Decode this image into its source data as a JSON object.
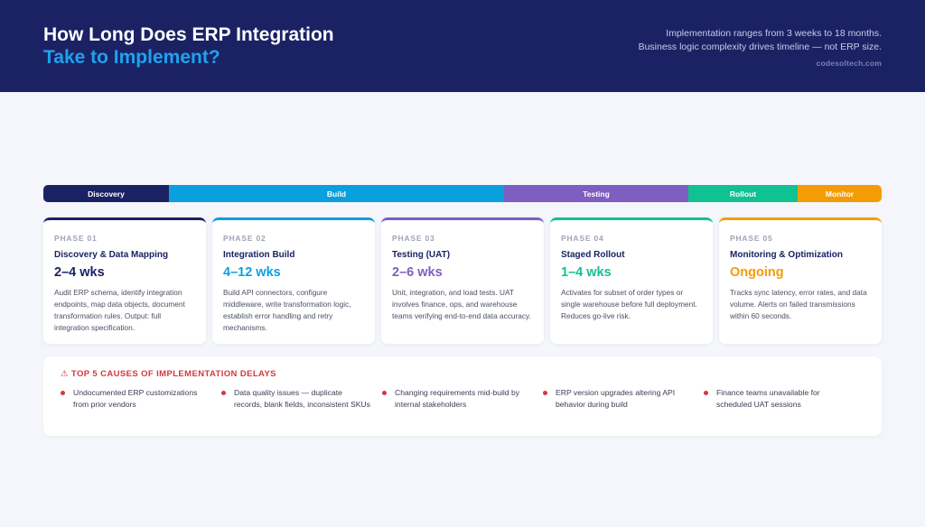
{
  "header": {
    "title_line1": "How Long Does ERP Integration",
    "title_line2": "Take to Implement?",
    "subtitle_line1": "Implementation ranges from 3 weeks to 18 months.",
    "subtitle_line2": "Business logic complexity drives timeline — not ERP size.",
    "site": "codesoltech.com"
  },
  "timeline": [
    {
      "label": "Discovery",
      "color": "#1b2264"
    },
    {
      "label": "Build",
      "color": "#0aa0de"
    },
    {
      "label": "Testing",
      "color": "#7f5ec1"
    },
    {
      "label": "Rollout",
      "color": "#10c192"
    },
    {
      "label": "Monitor",
      "color": "#f49c06"
    }
  ],
  "phases": [
    {
      "num": "PHASE 01",
      "title": "Discovery & Data Mapping",
      "duration": "2–4 wks",
      "color": "#1b2264",
      "desc": "Audit ERP schema, identify integration endpoints, map data objects, document transformation rules. Output: full integration specification."
    },
    {
      "num": "PHASE 02",
      "title": "Integration Build",
      "duration": "4–12 wks",
      "color": "#0aa0de",
      "desc": "Build API connectors, configure middleware, write transformation logic, establish error handling and retry mechanisms."
    },
    {
      "num": "PHASE 03",
      "title": "Testing (UAT)",
      "duration": "2–6 wks",
      "color": "#7f5ec1",
      "desc": "Unit, integration, and load tests. UAT involves finance, ops, and warehouse teams verifying end-to-end data accuracy."
    },
    {
      "num": "PHASE 04",
      "title": "Staged Rollout",
      "duration": "1–4 wks",
      "color": "#10c192",
      "desc": "Activates for subset of order types or single warehouse before full deployment. Reduces go-live risk."
    },
    {
      "num": "PHASE 05",
      "title": "Monitoring & Optimization",
      "duration": "Ongoing",
      "color": "#f49c06",
      "desc": "Tracks sync latency, error rates, and data volume. Alerts on failed transmissions within 60 seconds."
    }
  ],
  "causes": {
    "icon": "warning-icon",
    "title": "TOP 5 CAUSES OF IMPLEMENTATION DELAYS",
    "items": [
      "Undocumented ERP customizations from prior vendors",
      "Data quality issues — duplicate records, blank fields, inconsistent SKUs",
      "Changing requirements mid-build by internal stakeholders",
      "ERP version upgrades altering API behavior during build",
      "Finance teams unavailable for scheduled UAT sessions"
    ]
  }
}
